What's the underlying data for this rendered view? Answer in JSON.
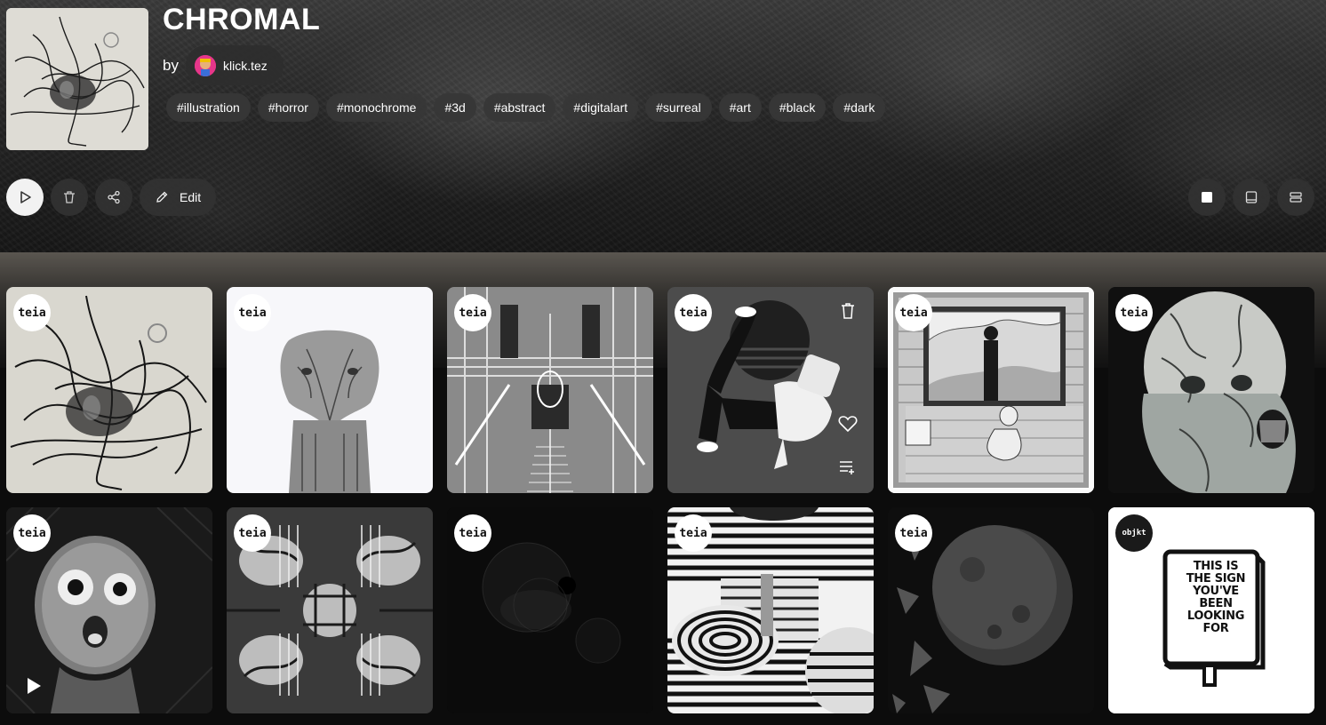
{
  "header": {
    "title": "CHROMAL",
    "by_label": "by",
    "author": "klick.tez"
  },
  "tags": [
    "#illustration",
    "#horror",
    "#monochrome",
    "#3d",
    "#abstract",
    "#digitalart",
    "#surreal",
    "#art",
    "#black",
    "#dark"
  ],
  "toolbar": {
    "edit_label": "Edit"
  },
  "cards": [
    {
      "badge": "teia",
      "art": "scribble-face"
    },
    {
      "badge": "teia",
      "art": "mirrored-faces"
    },
    {
      "badge": "teia",
      "art": "glitch-temple"
    },
    {
      "badge": "teia",
      "art": "falling-figure"
    },
    {
      "badge": "teia",
      "art": "framed-room"
    },
    {
      "badge": "teia",
      "art": "cracked-head"
    },
    {
      "badge": "teia",
      "art": "screaming-skull"
    },
    {
      "badge": "teia",
      "art": "chrome-kaleidoscope"
    },
    {
      "badge": "teia",
      "art": "dark-spheres"
    },
    {
      "badge": "teia",
      "art": "striped-room"
    },
    {
      "badge": "teia",
      "art": "dark-planet"
    },
    {
      "badge": "objkt",
      "art": "sign-drawing"
    }
  ],
  "sign_text": [
    "THIS IS",
    "THE SIGN",
    "YOU'VE",
    "BEEN",
    "LOOKING",
    "FOR"
  ],
  "colors": {
    "background": "#0c0c0c",
    "chip": "#373737",
    "avatar": "#e6368a"
  }
}
